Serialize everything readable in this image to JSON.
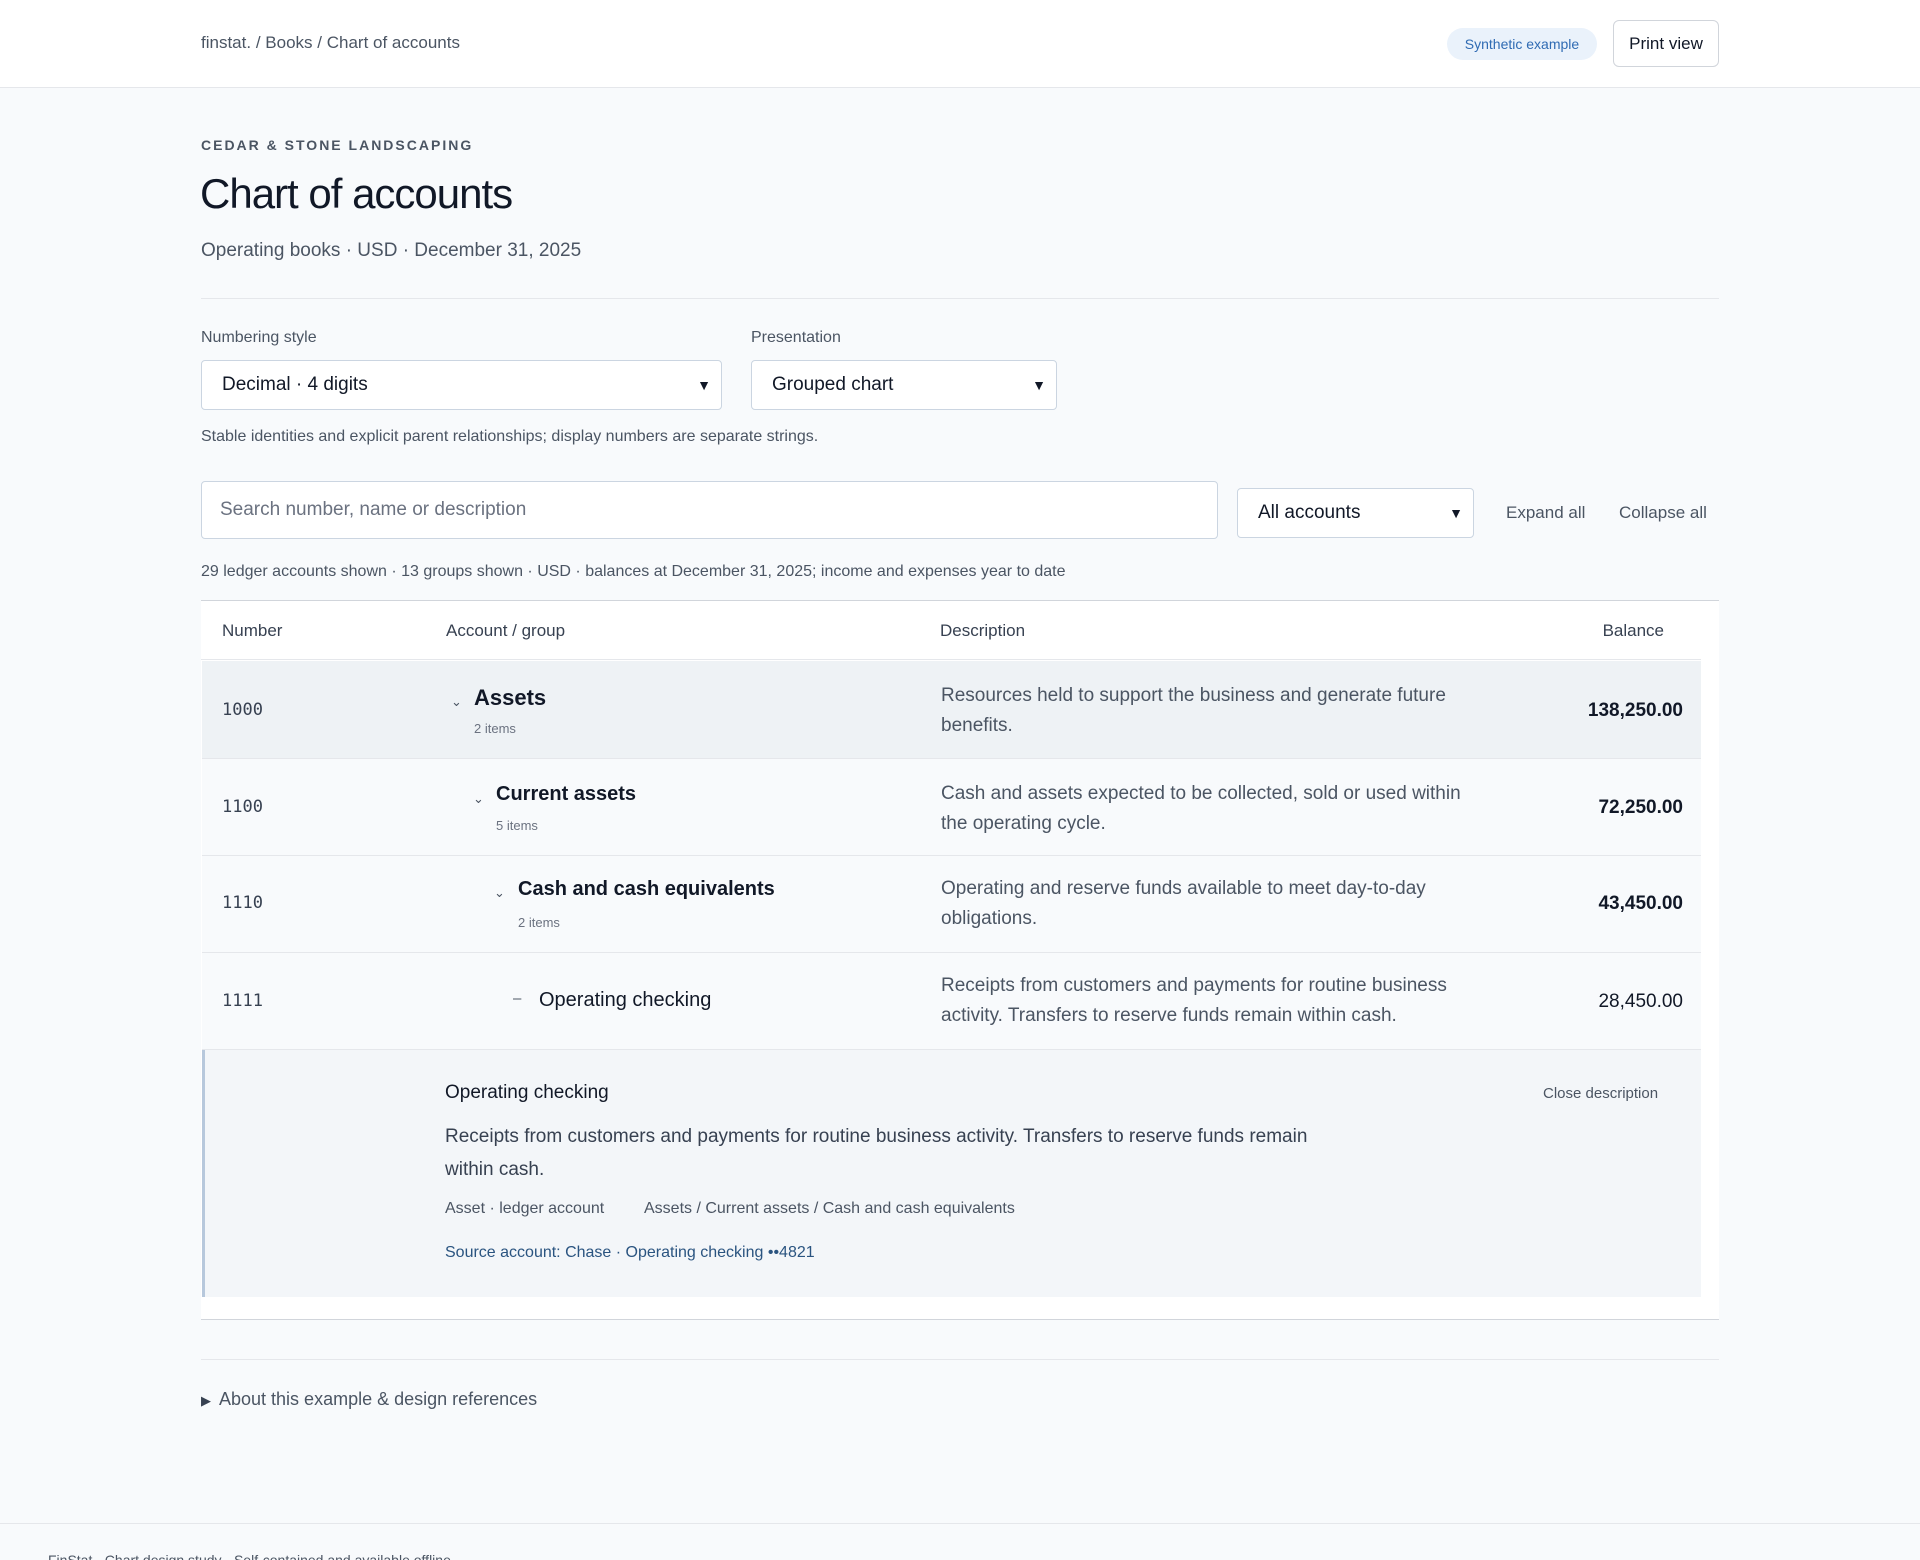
{
  "header": {
    "breadcrumb": [
      "finstat.",
      "Books",
      "Chart of accounts"
    ],
    "badge": "Synthetic example",
    "print_label": "Print view"
  },
  "page": {
    "company": "CEDAR & STONE LANDSCAPING",
    "title": "Chart of accounts",
    "subtitle": "Operating books · USD · December 31, 2025"
  },
  "controls": {
    "numbering_label": "Numbering style",
    "numbering_value": "Decimal · 4 digits",
    "presentation_label": "Presentation",
    "presentation_value": "Grouped chart",
    "hint": "Stable identities and explicit parent relationships; display numbers are separate strings.",
    "search_placeholder": "Search number, name or description",
    "filter_value": "All accounts",
    "expand_all": "Expand all",
    "collapse_all": "Collapse all",
    "summary": "29 ledger accounts shown · 13 groups shown · USD · balances at December 31, 2025; income and expenses year to date"
  },
  "table": {
    "columns": [
      "Number",
      "Account / group",
      "Description",
      "Balance"
    ],
    "rows": [
      {
        "number": "1000",
        "name": "Assets",
        "count": "2 items",
        "description": "Resources held to support the business and generate future benefits.",
        "balance": "138,250.00",
        "toggle": "⌄"
      },
      {
        "number": "1100",
        "name": "Current assets",
        "count": "5 items",
        "description": "Cash and assets expected to be collected, sold or used within the operating cycle.",
        "balance": "72,250.00",
        "toggle": "⌄"
      },
      {
        "number": "1110",
        "name": "Cash and cash equivalents",
        "count": "2 items",
        "description": "Operating and reserve funds available to meet day-to-day obligations.",
        "balance": "43,450.00",
        "toggle": "⌄"
      },
      {
        "number": "1111",
        "name": "Operating checking",
        "count": "",
        "description": "Receipts from customers and payments for routine business activity. Transfers to reserve funds remain within cash.",
        "balance": "28,450.00",
        "toggle": "–"
      }
    ],
    "detail": {
      "title": "Operating checking",
      "close": "Close description",
      "text": "Receipts from customers and payments for routine business activity. Transfers to reserve funds remain within cash.",
      "type": "Asset · ledger account",
      "path": "Assets / Current assets / Cash and cash equivalents",
      "source": "Source account: Chase · Operating checking ••4821"
    }
  },
  "about": "About this example & design references",
  "footer": "FinStat · Chart design study · Self-contained and available offline"
}
